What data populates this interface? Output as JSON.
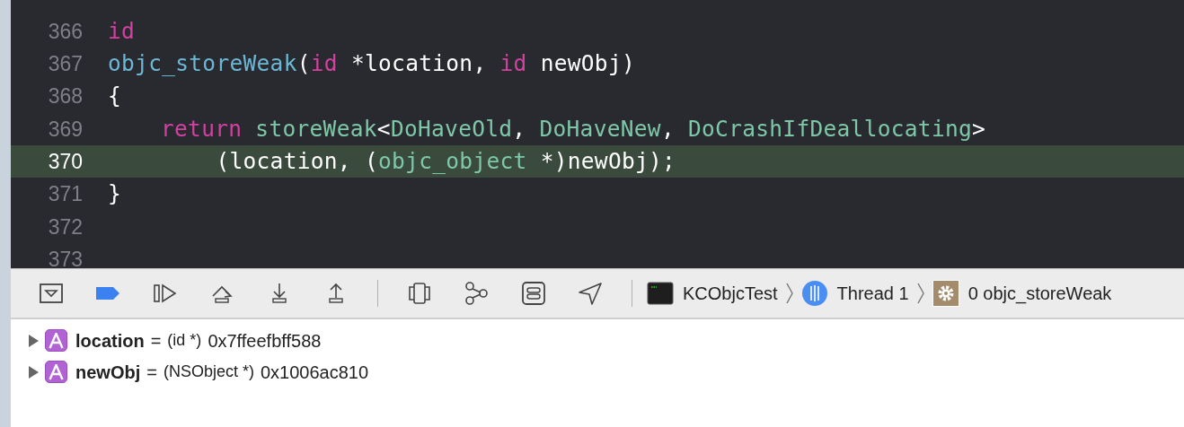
{
  "editor": {
    "lines": [
      {
        "number": "366",
        "selected": false,
        "tokens": [
          {
            "text": "id",
            "kind": "keyword"
          }
        ]
      },
      {
        "number": "367",
        "selected": false,
        "tokens": [
          {
            "text": "objc_storeWeak",
            "kind": "function"
          },
          {
            "text": "(",
            "kind": "plain"
          },
          {
            "text": "id",
            "kind": "keyword"
          },
          {
            "text": " *location, ",
            "kind": "plain"
          },
          {
            "text": "id",
            "kind": "keyword"
          },
          {
            "text": " newObj)",
            "kind": "plain"
          }
        ]
      },
      {
        "number": "368",
        "selected": false,
        "tokens": [
          {
            "text": "{",
            "kind": "plain"
          }
        ]
      },
      {
        "number": "369",
        "selected": false,
        "indented": true,
        "tokens": [
          {
            "text": "return ",
            "kind": "keyword"
          },
          {
            "text": "storeWeak",
            "kind": "type"
          },
          {
            "text": "<",
            "kind": "plain"
          },
          {
            "text": "DoHaveOld",
            "kind": "type"
          },
          {
            "text": ", ",
            "kind": "plain"
          },
          {
            "text": "DoHaveNew",
            "kind": "type"
          },
          {
            "text": ", ",
            "kind": "plain"
          },
          {
            "text": "DoCrashIfDeallocating",
            "kind": "type"
          },
          {
            "text": ">",
            "kind": "plain"
          }
        ]
      },
      {
        "number": "370",
        "selected": true,
        "tokens": [
          {
            "text": "        (location, (",
            "kind": "plain"
          },
          {
            "text": "objc_object",
            "kind": "type"
          },
          {
            "text": " *)newObj);",
            "kind": "plain"
          }
        ]
      },
      {
        "number": "371",
        "selected": false,
        "tokens": [
          {
            "text": "}",
            "kind": "plain"
          }
        ]
      },
      {
        "number": "372",
        "selected": false
      },
      {
        "number": "373",
        "selected": false
      }
    ]
  },
  "debug_bar": {
    "buttons": [
      {
        "kind": "hide",
        "on": false
      },
      {
        "kind": "breakpoints",
        "on": true
      },
      {
        "kind": "continue",
        "on": false
      },
      {
        "kind": "step_over",
        "on": false
      },
      {
        "kind": "step_into",
        "on": false
      },
      {
        "kind": "step_out",
        "on": false
      },
      {
        "kind": "separator"
      },
      {
        "kind": "view_debugger",
        "on": false
      },
      {
        "kind": "memory_graph",
        "on": false
      },
      {
        "kind": "environment",
        "on": false
      },
      {
        "kind": "location",
        "on": false
      },
      {
        "kind": "separator"
      }
    ],
    "breadcrumb": [
      {
        "kind": "app",
        "text": "KCObjcTest"
      },
      {
        "kind": "thread",
        "text": "Thread 1"
      },
      {
        "kind": "frame",
        "text": "0 objc_storeWeak"
      }
    ]
  },
  "variables": [
    {
      "name": "location",
      "equals": "=",
      "type": "(id *)",
      "value": "0x7ffeefbff588",
      "expanded": false
    },
    {
      "name": "newObj",
      "equals": "=",
      "type": "(NSObject *)",
      "value": "0x1006ac810",
      "expanded": false
    }
  ]
}
